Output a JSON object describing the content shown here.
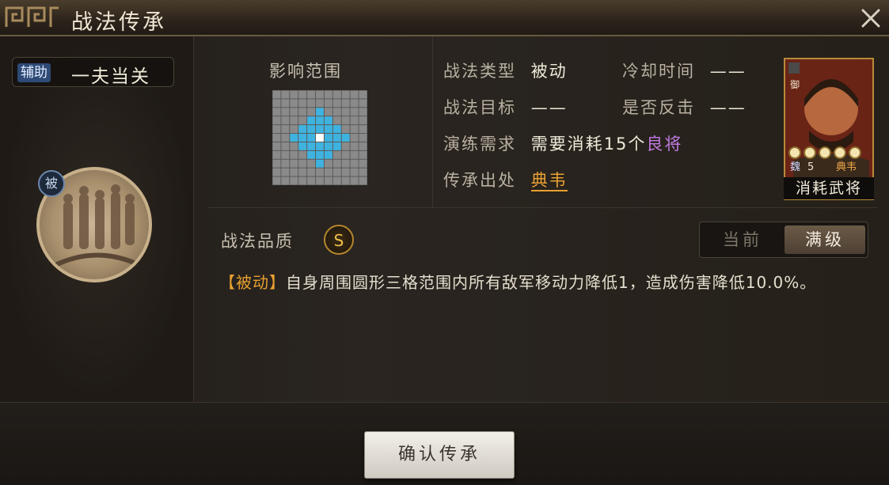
{
  "window": {
    "title": "战法传承",
    "close_icon": "close-icon"
  },
  "skill": {
    "category_tag": "辅助",
    "name": "一夫当关",
    "type_badge": "被"
  },
  "range": {
    "label": "影响范围",
    "grid_size": 11,
    "center": [
      5,
      5
    ],
    "radius": 3,
    "colors": {
      "cell": "#8a8a8a",
      "area": "#3fb3e0",
      "center": "#ffffff",
      "line": "#5a5a5a"
    }
  },
  "info": {
    "type_label": "战法类型",
    "type_value": "被动",
    "cooldown_label": "冷却时间",
    "cooldown_value": "——",
    "target_label": "战法目标",
    "target_value": "——",
    "counter_label": "是否反击",
    "counter_value": "——",
    "train_label": "演练需求",
    "train_prefix": "需要消耗",
    "train_count": "15",
    "train_unit": "个",
    "train_quality": "良将",
    "source_label": "传承出处",
    "source_value": "典韦"
  },
  "hero_card": {
    "seal": "御",
    "faction": "魏",
    "cost": "5",
    "name": "典韦",
    "stars": 5,
    "footer": "消耗武将"
  },
  "quality": {
    "label": "战法品质",
    "grade": "S"
  },
  "level_toggle": {
    "current": "当前",
    "max": "满级",
    "selected": "max"
  },
  "description": {
    "tag": "【被动】",
    "text": "自身周围圆形三格范围内所有敌军移动力降低1，造成伤害降低10.0%。"
  },
  "confirm": {
    "label": "确认传承"
  }
}
